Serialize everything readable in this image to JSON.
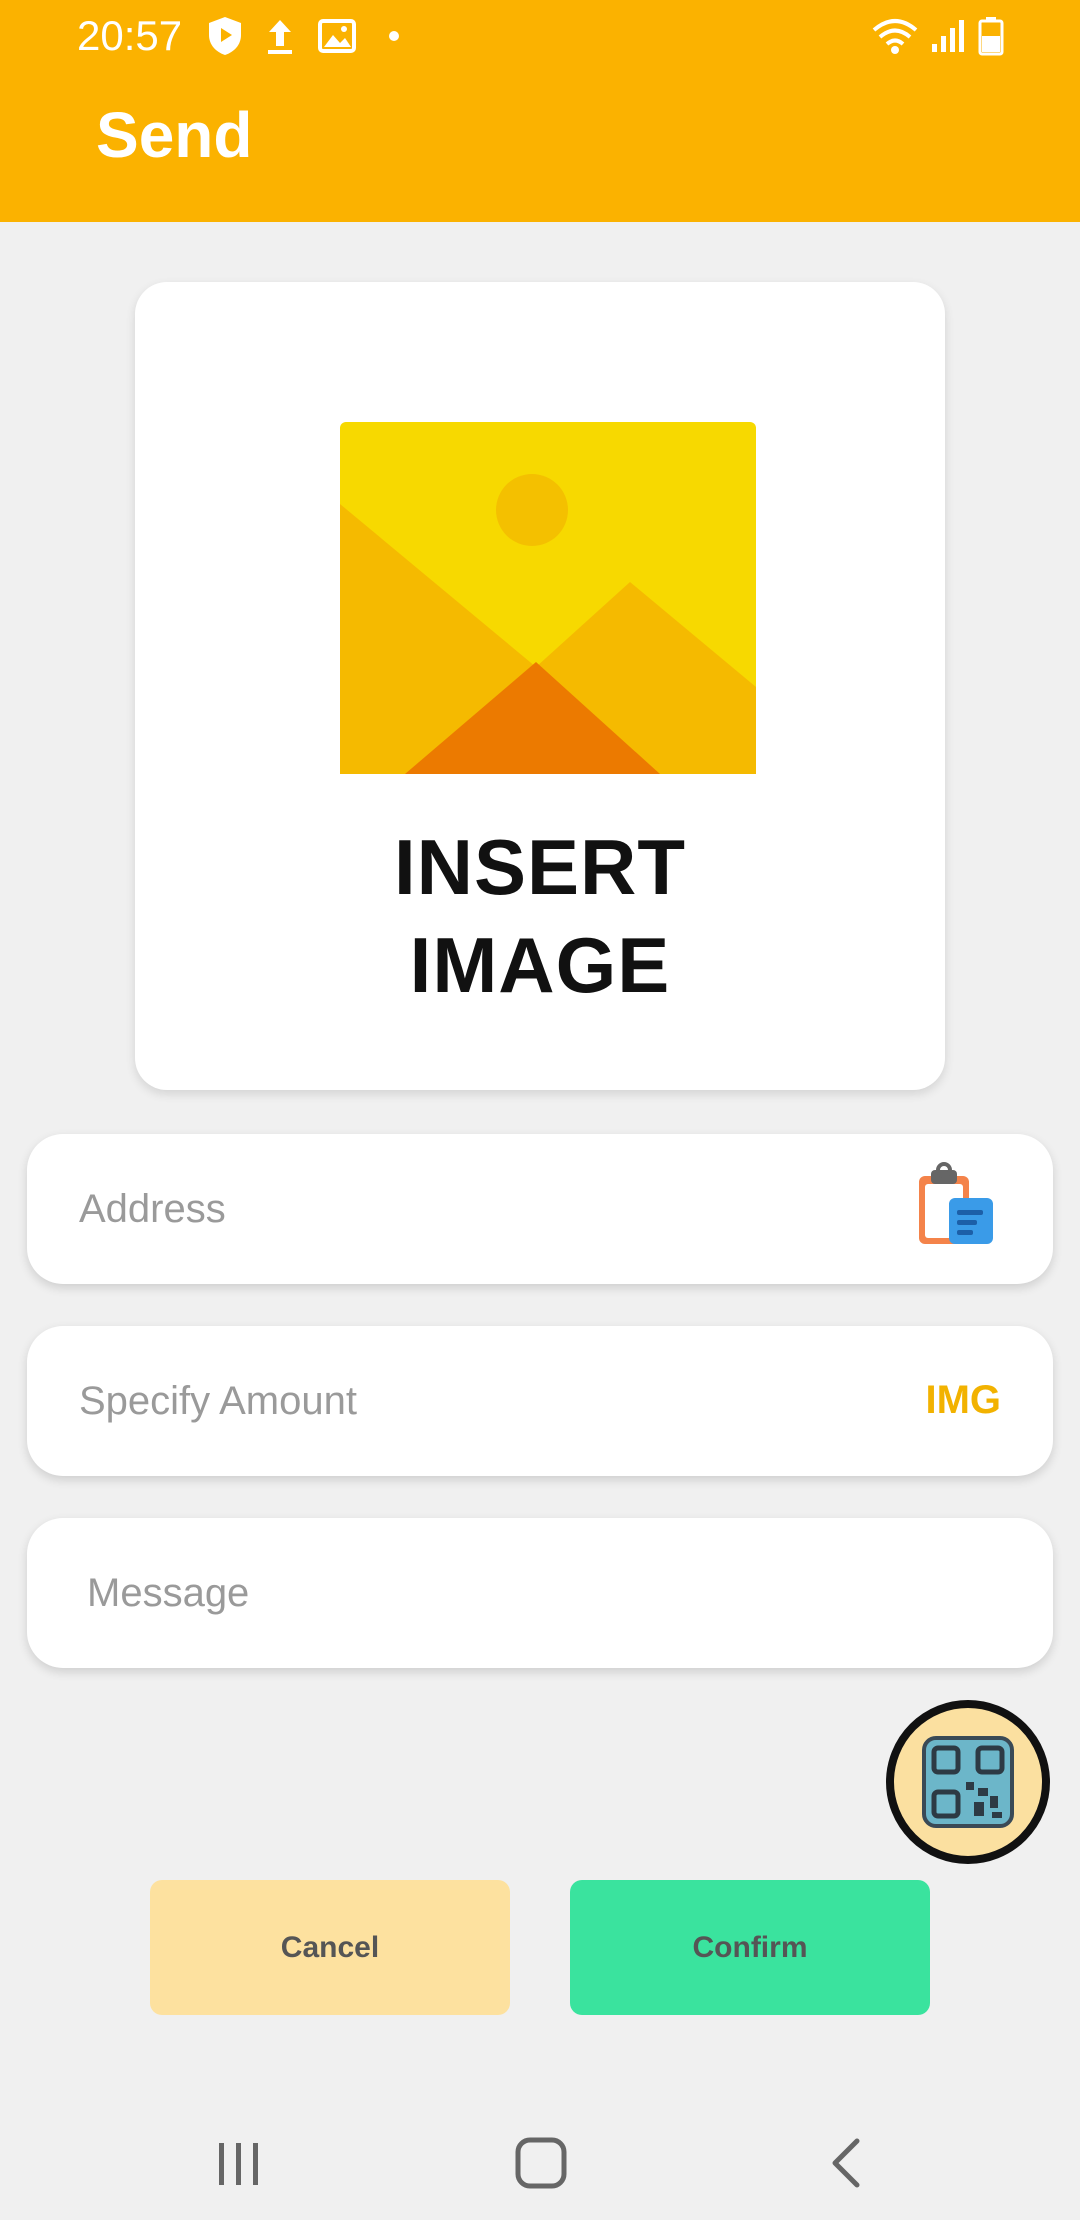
{
  "status_bar": {
    "time": "20:57",
    "left_icons": [
      "shield-play-icon",
      "upload-icon",
      "image-icon",
      "notification-dot-icon"
    ],
    "right_icons": [
      "wifi-icon",
      "signal-icon",
      "battery-icon"
    ]
  },
  "header": {
    "title": "Send",
    "background_color": "#fbb200"
  },
  "image_card": {
    "line1": "INSERT",
    "line2": "IMAGE"
  },
  "form": {
    "address_placeholder": "Address",
    "amount_placeholder": "Specify Amount",
    "amount_unit": "IMG",
    "message_placeholder": "Message"
  },
  "actions": {
    "cancel_label": "Cancel",
    "confirm_label": "Confirm",
    "cancel_color": "#fde19f",
    "confirm_color": "#3ae39e"
  },
  "nav": {
    "items": [
      "recent-apps-icon",
      "home-icon",
      "back-icon"
    ]
  }
}
